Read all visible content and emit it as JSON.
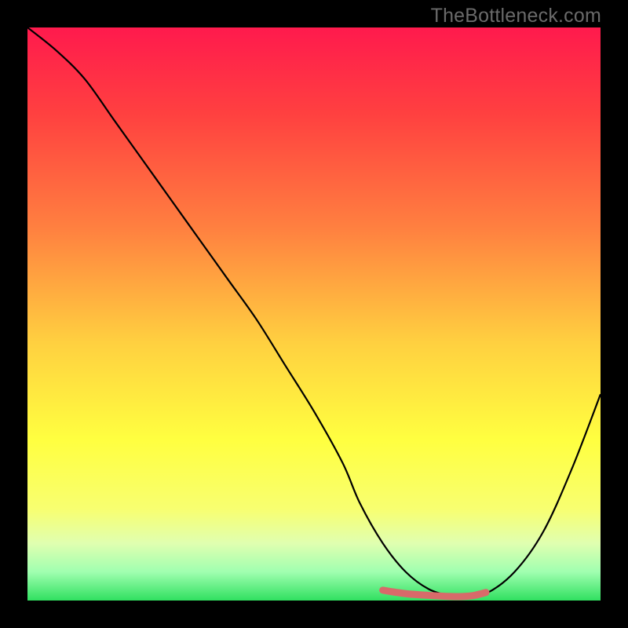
{
  "watermark": "TheBottleneck.com",
  "chart_data": {
    "type": "line",
    "title": "",
    "xlabel": "",
    "ylabel": "",
    "xlim": [
      0,
      100
    ],
    "ylim": [
      0,
      100
    ],
    "series": [
      {
        "name": "bottleneck-curve",
        "x": [
          0,
          5,
          10,
          15,
          20,
          25,
          30,
          35,
          40,
          45,
          50,
          55,
          58,
          62,
          66,
          70,
          74,
          76,
          80,
          85,
          90,
          95,
          100
        ],
        "values": [
          100,
          96,
          91,
          84,
          77,
          70,
          63,
          56,
          49,
          41,
          33,
          24,
          17,
          10,
          5,
          2,
          0.7,
          0.5,
          1.2,
          5,
          12,
          23,
          36
        ]
      },
      {
        "name": "optimal-segment",
        "x": [
          62,
          66,
          70,
          74,
          76,
          78,
          80
        ],
        "values": [
          1.8,
          1.2,
          0.9,
          0.7,
          0.7,
          0.9,
          1.4
        ]
      }
    ],
    "gradient_stops": [
      {
        "offset": 0.0,
        "color": "#ff1a4d"
      },
      {
        "offset": 0.15,
        "color": "#ff4040"
      },
      {
        "offset": 0.35,
        "color": "#ff8040"
      },
      {
        "offset": 0.55,
        "color": "#ffd040"
      },
      {
        "offset": 0.72,
        "color": "#ffff40"
      },
      {
        "offset": 0.84,
        "color": "#f8ff70"
      },
      {
        "offset": 0.9,
        "color": "#e0ffb0"
      },
      {
        "offset": 0.95,
        "color": "#a0ffb0"
      },
      {
        "offset": 1.0,
        "color": "#30e060"
      }
    ],
    "curve_color": "#000000",
    "optimal_color": "#d86a6a"
  }
}
